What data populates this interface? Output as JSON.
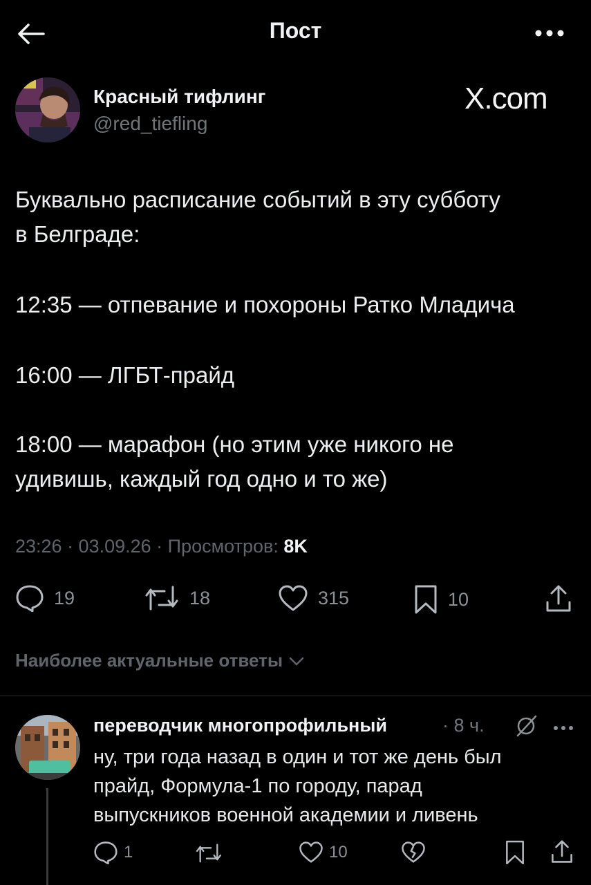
{
  "header": {
    "title": "Пост"
  },
  "post": {
    "author_name": "Красный тифлинг",
    "author_handle": "@red_tiefling",
    "watermark": "X.com",
    "lines": [
      "Буквально расписание событий в эту субботу",
      "в Белграде:",
      "12:35 — отпевание и похороны Ратко Младича",
      "16:00 — ЛГБТ-прайд",
      "18:00 — марафон (но этим уже никого не",
      "удивишь, каждый год одно и то же)"
    ],
    "meta_time": "23:26 · 03.09.26 · Просмотров: ",
    "meta_views": "8K",
    "actions": {
      "replies": "19",
      "reposts": "18",
      "likes": "315",
      "bookmarks": "10"
    }
  },
  "replies_section": {
    "label": "Наиболее актуальные ответы"
  },
  "reply": {
    "author_name": "переводчик многопрофильный",
    "time": "· 8 ч.",
    "lines": [
      "ну, три года назад в один и тот же день был",
      "прайд, Формула-1 по городу, парад",
      "выпускников военной академии и ливень"
    ],
    "actions": {
      "replies": "1",
      "likes": "10"
    }
  },
  "colors": {
    "background": "#000000",
    "text": "#e7e9ea",
    "muted": "#71767b"
  }
}
